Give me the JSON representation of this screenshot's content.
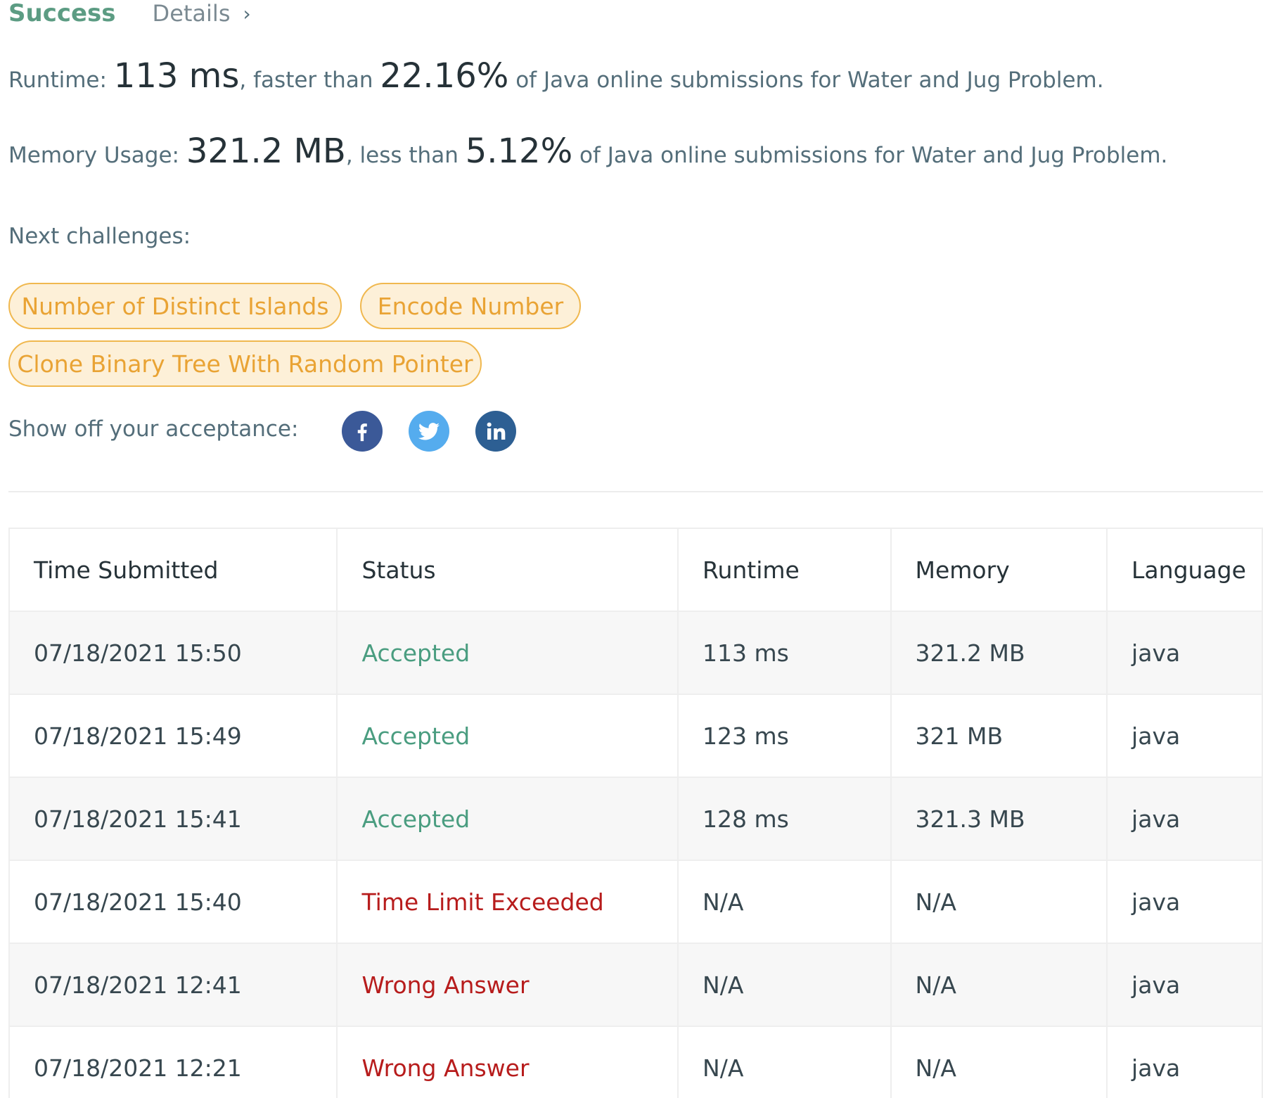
{
  "header": {
    "title": "Success",
    "details_label": "Details",
    "chevron": "›"
  },
  "runtime": {
    "label": "Runtime: ",
    "value": "113 ms",
    "comparator": ", faster than ",
    "percent": "22.16%",
    "suffix": " of Java online submissions for Water and Jug Problem."
  },
  "memory": {
    "label": "Memory Usage: ",
    "value": "321.2 MB",
    "comparator": ", less than ",
    "percent": "5.12%",
    "suffix": " of Java online submissions for Water and Jug Problem."
  },
  "next": {
    "label": "Next challenges:",
    "challenges": [
      "Number of Distinct Islands",
      "Encode Number",
      "Clone Binary Tree With Random Pointer"
    ]
  },
  "share": {
    "label": "Show off your acceptance:",
    "icons": [
      "facebook-icon",
      "twitter-icon",
      "linkedin-icon"
    ],
    "colors": {
      "facebook": "#3b5998",
      "twitter": "#55acee",
      "linkedin": "#0077b5"
    }
  },
  "table": {
    "headers": [
      "Time Submitted",
      "Status",
      "Runtime",
      "Memory",
      "Language"
    ],
    "rows": [
      {
        "time": "07/18/2021 15:50",
        "status": "Accepted",
        "runtime": "113 ms",
        "memory": "321.2 MB",
        "language": "java"
      },
      {
        "time": "07/18/2021 15:49",
        "status": "Accepted",
        "runtime": "123 ms",
        "memory": "321 MB",
        "language": "java"
      },
      {
        "time": "07/18/2021 15:41",
        "status": "Accepted",
        "runtime": "128 ms",
        "memory": "321.3 MB",
        "language": "java"
      },
      {
        "time": "07/18/2021 15:40",
        "status": "Time Limit Exceeded",
        "runtime": "N/A",
        "memory": "N/A",
        "language": "java"
      },
      {
        "time": "07/18/2021 12:41",
        "status": "Wrong Answer",
        "runtime": "N/A",
        "memory": "N/A",
        "language": "java"
      },
      {
        "time": "07/18/2021 12:21",
        "status": "Wrong Answer",
        "runtime": "N/A",
        "memory": "N/A",
        "language": "java"
      }
    ]
  },
  "colors": {
    "success": "#5c9c83",
    "accepted": "#4a9d80",
    "failed": "#b71c1c",
    "challenge_border": "#f0b84f",
    "challenge_bg": "#fdf0d8",
    "challenge_text": "#e9a334"
  }
}
